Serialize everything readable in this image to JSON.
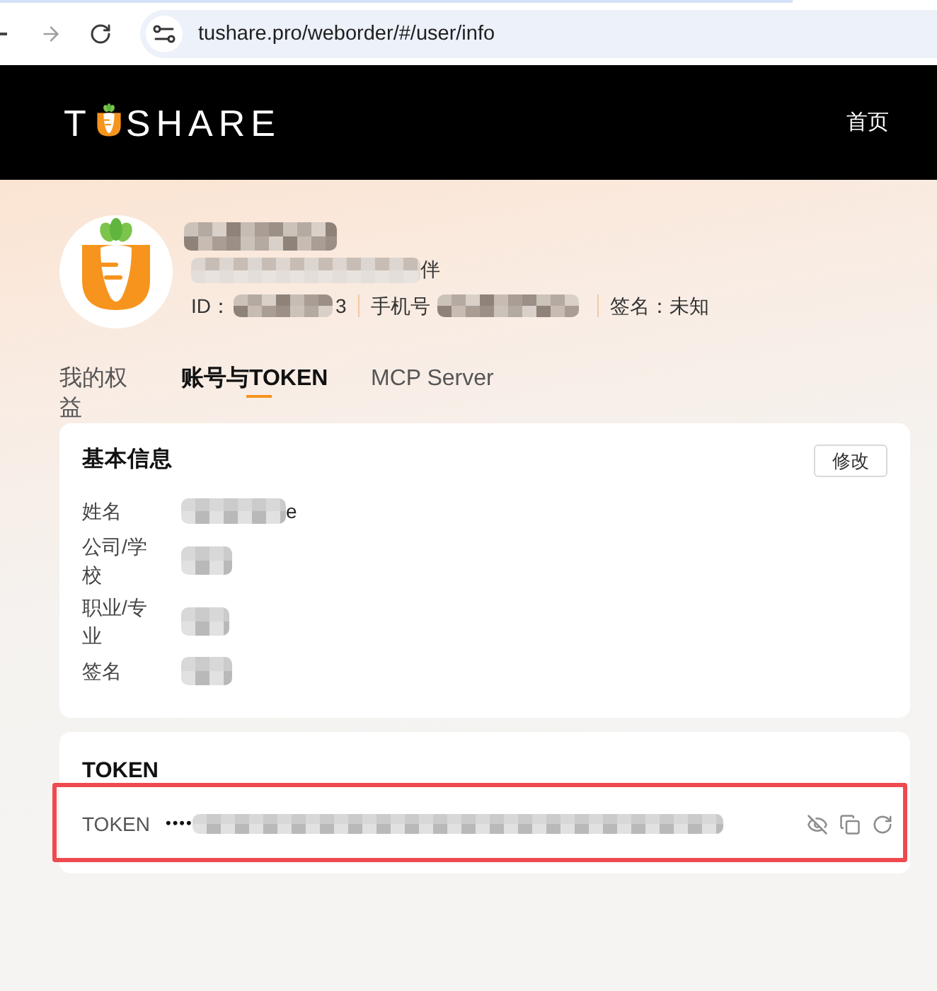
{
  "browser": {
    "url": "tushare.pro/weborder/#/user/info"
  },
  "header": {
    "logo": [
      "T",
      "SHARE"
    ],
    "nav": [
      {
        "label": "首页"
      }
    ]
  },
  "profile": {
    "name": [
      {
        "kind": "blur"
      }
    ],
    "subtitle": [
      {
        "kind": "blur"
      },
      {
        "kind": "text",
        "text": "伴"
      }
    ],
    "meta": [
      [
        {
          "kind": "text",
          "text": "ID："
        },
        {
          "kind": "blur"
        },
        {
          "kind": "text",
          "text": "3"
        }
      ],
      [
        {
          "kind": "text",
          "text": "手机号"
        },
        {
          "kind": "blur"
        }
      ],
      [
        {
          "kind": "text",
          "text": "签名：未知"
        }
      ]
    ]
  },
  "tabs": [
    {
      "label": "我的权益",
      "selected": false
    },
    {
      "label": "账号与TOKEN",
      "selected": true
    },
    {
      "label": "MCP Server",
      "selected": false
    }
  ],
  "basic_info": {
    "title": "基本信息",
    "edit_button": "修改",
    "rows": [
      {
        "label": "姓名",
        "value": [
          {
            "kind": "blur"
          },
          {
            "kind": "text",
            "text": "e"
          }
        ]
      },
      {
        "label": "公司/学校",
        "value": [
          {
            "kind": "blur"
          }
        ]
      },
      {
        "label": "职业/专业",
        "value": [
          {
            "kind": "blur"
          }
        ]
      },
      {
        "label": "签名",
        "value": [
          {
            "kind": "blur"
          }
        ]
      }
    ]
  },
  "token_card": {
    "title": "TOKEN",
    "row": {
      "label": "TOKEN",
      "highlighted": true,
      "value": [
        {
          "kind": "text",
          "text": "••••"
        },
        {
          "kind": "blur"
        }
      ],
      "actions": [
        {
          "kind": "toggle-visibility"
        },
        {
          "kind": "copy"
        },
        {
          "kind": "refresh"
        }
      ]
    }
  }
}
